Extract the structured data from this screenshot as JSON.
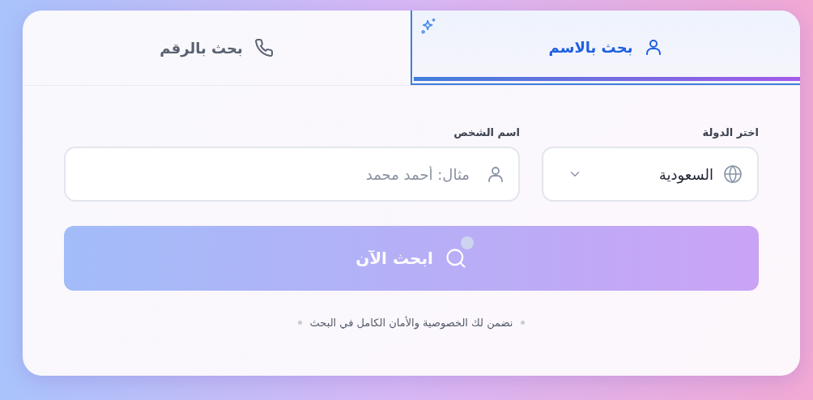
{
  "tabs": [
    {
      "label": "بحث بالاسم",
      "kind": "person",
      "selected": true
    },
    {
      "label": "بحث بالرقم",
      "kind": "phone",
      "selected": false
    }
  ],
  "country": {
    "label": "اختر الدولة",
    "value": "السعودية"
  },
  "name": {
    "label": "اسم الشخص",
    "placeholder": "مثال: أحمد محمد"
  },
  "search_button": {
    "label": "ابحث الآن",
    "disabled": true
  },
  "footnote": "نضمن لك الخصوصية والأمان الكامل في البحث"
}
